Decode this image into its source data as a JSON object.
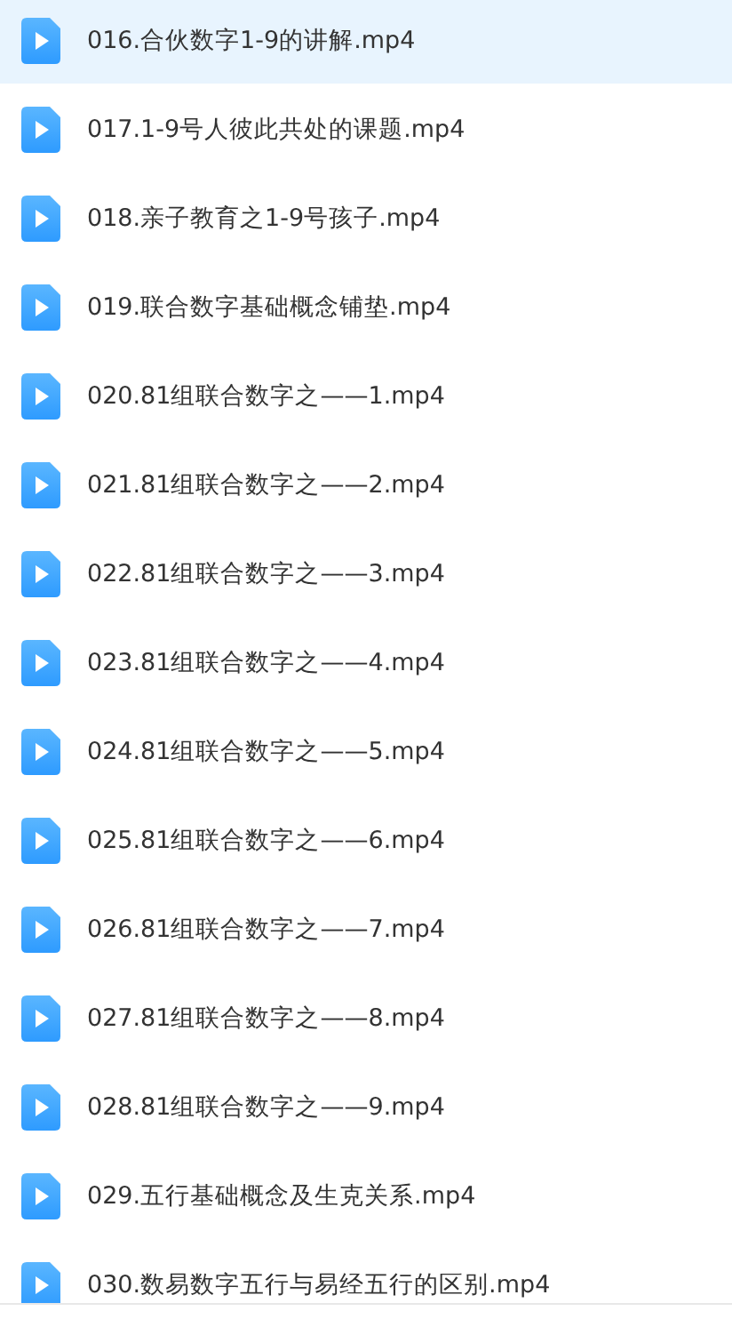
{
  "files": [
    {
      "name": "016.合伙数字1-9的讲解.mp4",
      "selected": true
    },
    {
      "name": "017.1-9号人彼此共处的课题.mp4",
      "selected": false
    },
    {
      "name": "018.亲子教育之1-9号孩子.mp4",
      "selected": false
    },
    {
      "name": "019.联合数字基础概念铺垫.mp4",
      "selected": false
    },
    {
      "name": "020.81组联合数字之——1.mp4",
      "selected": false
    },
    {
      "name": "021.81组联合数字之——2.mp4",
      "selected": false
    },
    {
      "name": "022.81组联合数字之——3.mp4",
      "selected": false
    },
    {
      "name": "023.81组联合数字之——4.mp4",
      "selected": false
    },
    {
      "name": "024.81组联合数字之——5.mp4",
      "selected": false
    },
    {
      "name": "025.81组联合数字之——6.mp4",
      "selected": false
    },
    {
      "name": "026.81组联合数字之——7.mp4",
      "selected": false
    },
    {
      "name": "027.81组联合数字之——8.mp4",
      "selected": false
    },
    {
      "name": "028.81组联合数字之——9.mp4",
      "selected": false
    },
    {
      "name": "029.五行基础概念及生克关系.mp4",
      "selected": false
    },
    {
      "name": "030.数易数字五行与易经五行的区别.mp4",
      "selected": false
    }
  ]
}
